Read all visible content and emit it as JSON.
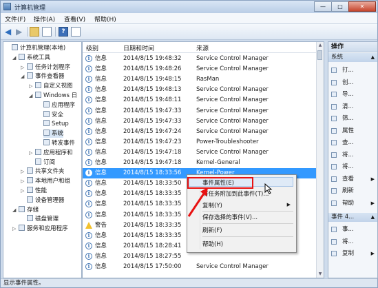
{
  "window": {
    "title": "计算机管理",
    "caption": {
      "minimize": "—",
      "maximize": "□",
      "close": "✕"
    }
  },
  "menu": [
    "文件(F)",
    "操作(A)",
    "查看(V)",
    "帮助(H)"
  ],
  "toolbar": {
    "back": "◀",
    "forward": "▶",
    "help": "?"
  },
  "tree": [
    {
      "label": "计算机管理(本地)",
      "icon": "computer-icon",
      "level": 0,
      "expand": ""
    },
    {
      "label": "系统工具",
      "icon": "tools-icon",
      "level": 1,
      "expand": "◢"
    },
    {
      "label": "任务计划程序",
      "icon": "clock-icon",
      "level": 2,
      "expand": "▷"
    },
    {
      "label": "事件查看器",
      "icon": "event-viewer-icon",
      "level": 2,
      "expand": "◢"
    },
    {
      "label": "自定义视图",
      "icon": "folder-icon",
      "level": 3,
      "expand": "▷"
    },
    {
      "label": "Windows 日",
      "icon": "folder-icon",
      "level": 3,
      "expand": "◢"
    },
    {
      "label": "应用程序",
      "icon": "log-icon",
      "level": 4,
      "expand": ""
    },
    {
      "label": "安全",
      "icon": "log-icon",
      "level": 4,
      "expand": ""
    },
    {
      "label": "Setup",
      "icon": "log-icon",
      "level": 4,
      "expand": ""
    },
    {
      "label": "系统",
      "icon": "log-icon",
      "level": 4,
      "expand": "",
      "selected": true
    },
    {
      "label": "转发事件",
      "icon": "log-icon",
      "level": 4,
      "expand": ""
    },
    {
      "label": "应用程序和",
      "icon": "folder-icon",
      "level": 3,
      "expand": "▷"
    },
    {
      "label": "订阅",
      "icon": "subscription-icon",
      "level": 3,
      "expand": ""
    },
    {
      "label": "共享文件夹",
      "icon": "shared-folder-icon",
      "level": 2,
      "expand": "▷"
    },
    {
      "label": "本地用户和组",
      "icon": "users-icon",
      "level": 2,
      "expand": "▷"
    },
    {
      "label": "性能",
      "icon": "performance-icon",
      "level": 2,
      "expand": "▷"
    },
    {
      "label": "设备管理器",
      "icon": "device-manager-icon",
      "level": 2,
      "expand": ""
    },
    {
      "label": "存储",
      "icon": "storage-icon",
      "level": 1,
      "expand": "◢"
    },
    {
      "label": "磁盘管理",
      "icon": "disk-icon",
      "level": 2,
      "expand": ""
    },
    {
      "label": "服务和应用程序",
      "icon": "services-icon",
      "level": 1,
      "expand": "▷"
    }
  ],
  "list": {
    "columns": [
      "级别",
      "日期和时间",
      "来源"
    ],
    "rows": [
      {
        "level": "信息",
        "type": "info",
        "datetime": "2014/8/15 19:48:32",
        "source": "Service Control Manager"
      },
      {
        "level": "信息",
        "type": "info",
        "datetime": "2014/8/15 19:48:26",
        "source": "Service Control Manager"
      },
      {
        "level": "信息",
        "type": "info",
        "datetime": "2014/8/15 19:48:15",
        "source": "RasMan"
      },
      {
        "level": "信息",
        "type": "info",
        "datetime": "2014/8/15 19:48:13",
        "source": "Service Control Manager"
      },
      {
        "level": "信息",
        "type": "info",
        "datetime": "2014/8/15 19:48:11",
        "source": "Service Control Manager"
      },
      {
        "level": "信息",
        "type": "info",
        "datetime": "2014/8/15 19:47:33",
        "source": "Service Control Manager"
      },
      {
        "level": "信息",
        "type": "info",
        "datetime": "2014/8/15 19:47:33",
        "source": "Service Control Manager"
      },
      {
        "level": "信息",
        "type": "info",
        "datetime": "2014/8/15 19:47:24",
        "source": "Service Control Manager"
      },
      {
        "level": "信息",
        "type": "info",
        "datetime": "2014/8/15 19:47:23",
        "source": "Power-Troubleshooter"
      },
      {
        "level": "信息",
        "type": "info",
        "datetime": "2014/8/15 19:47:18",
        "source": "Service Control Manager"
      },
      {
        "level": "信息",
        "type": "info",
        "datetime": "2014/8/15 19:47:18",
        "source": "Kernel-General"
      },
      {
        "level": "信息",
        "type": "info",
        "datetime": "2014/8/15 18:33:56",
        "source": "Kernel-Power",
        "selected": true
      },
      {
        "level": "信息",
        "type": "info",
        "datetime": "2014/8/15 18:33:50",
        "source": ""
      },
      {
        "level": "信息",
        "type": "info",
        "datetime": "2014/8/15 18:33:35",
        "source": ""
      },
      {
        "level": "信息",
        "type": "info",
        "datetime": "2014/8/15 18:33:35",
        "source": ""
      },
      {
        "level": "信息",
        "type": "info",
        "datetime": "2014/8/15 18:33:35",
        "source": ""
      },
      {
        "level": "警告",
        "type": "warning",
        "datetime": "2014/8/15 18:33:35",
        "source": ""
      },
      {
        "level": "信息",
        "type": "info",
        "datetime": "2014/8/15 18:33:35",
        "source": ""
      },
      {
        "level": "信息",
        "type": "info",
        "datetime": "2014/8/15 18:28:41",
        "source": ""
      },
      {
        "level": "信息",
        "type": "info",
        "datetime": "2014/8/15 18:27:55",
        "source": ""
      },
      {
        "level": "信息",
        "type": "info",
        "datetime": "2014/8/15 17:50:00",
        "source": "Service Control Manager"
      }
    ]
  },
  "context_menu": {
    "items": [
      {
        "label": "事件属性(E)",
        "highlighted": true
      },
      {
        "label": "将任务附加到此事件(T)..."
      },
      {
        "label": "复制(Y)",
        "submenu": true
      },
      {
        "label": "保存选择的事件(V)..."
      },
      {
        "label": "刷新(F)"
      },
      {
        "label": "帮助(H)"
      }
    ]
  },
  "actions": {
    "header": "操作",
    "section1": "系统",
    "items1": [
      {
        "label": "打...",
        "icon": "open-icon"
      },
      {
        "label": "创...",
        "icon": "filter-icon"
      },
      {
        "label": "导...",
        "icon": "import-icon"
      },
      {
        "label": "清...",
        "icon": "clear-icon"
      },
      {
        "label": "筛...",
        "icon": "filter-icon"
      },
      {
        "label": "属性",
        "icon": "properties-icon"
      },
      {
        "label": "查...",
        "icon": "find-icon"
      },
      {
        "label": "将...",
        "icon": "save-icon"
      },
      {
        "label": "将...",
        "icon": "attach-icon"
      },
      {
        "label": "查看",
        "icon": "view-icon",
        "submenu": true
      },
      {
        "label": "刷新",
        "icon": "refresh-icon"
      },
      {
        "label": "帮助",
        "icon": "help-icon",
        "submenu": true
      }
    ],
    "section2": "事件 4...",
    "items2": [
      {
        "label": "事...",
        "icon": "event-properties-icon"
      },
      {
        "label": "将...",
        "icon": "attach-icon"
      },
      {
        "label": "复制",
        "icon": "copy-icon",
        "submenu": true
      }
    ],
    "submenu_arrow": "▶",
    "section_arrow": "▲"
  },
  "status": "显示事件属性。",
  "colors": {
    "selection": "#3399ff",
    "highlight_border": "#e81212",
    "info_icon": "#3f74b3",
    "warning_icon": "#f2c12e"
  }
}
